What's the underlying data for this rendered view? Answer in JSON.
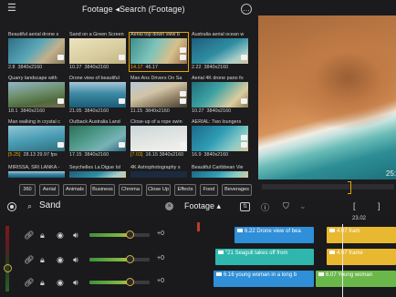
{
  "header": {
    "title": "Footage ◂Search (Footage)"
  },
  "grid": [
    {
      "caption": "Beautiful aerial drone s",
      "duration": "2.8",
      "resolution": "3840x2160",
      "thumb": "beach1",
      "selected": false
    },
    {
      "caption": "Sand on a Green Screen",
      "duration": "10.27",
      "resolution": "3840x2160",
      "thumb": "sand",
      "selected": false
    },
    {
      "caption": "Aerial top down view b",
      "duration": "14.17",
      "resolution": "46.17",
      "thumb": "aerial",
      "selected": true,
      "highlight": true
    },
    {
      "caption": "Australia aerial ocean w",
      "duration": "2.22",
      "resolution": "3840x2160",
      "thumb": "ocean",
      "selected": false
    },
    {
      "caption": "Quarry landscape with",
      "duration": "18.1",
      "resolution": "3840x2160",
      "thumb": "quarry",
      "selected": false
    },
    {
      "caption": "Drone view of beautiful",
      "duration": "21.05",
      "resolution": "3840x2160",
      "thumb": "drone",
      "selected": false
    },
    {
      "caption": "Man Ans Drivers On Sa",
      "duration": "11.15",
      "resolution": "3840x2160",
      "thumb": "road",
      "selected": false
    },
    {
      "caption": "Aerial 4K drone pano fo",
      "duration": "10.27",
      "resolution": "3840x2160",
      "thumb": "drone2",
      "selected": false
    },
    {
      "caption": "Man walking in crystal c",
      "duration": "[5.25]",
      "resolution": "28.13  29.97 fps",
      "thumb": "walk",
      "selected": false,
      "highlight": true
    },
    {
      "caption": "Outback Australia Land",
      "duration": "17.15",
      "resolution": "3840x2160",
      "thumb": "outback",
      "selected": false
    },
    {
      "caption": "Close-up of a rope swin",
      "duration": "[7.03]",
      "resolution": "16.15  3840x2160",
      "thumb": "rope",
      "selected": false,
      "highlight": true
    },
    {
      "caption": "AERIAL: Two loungers",
      "duration": "16.9",
      "resolution": "3840x2160",
      "thumb": "lagoon",
      "selected": false
    }
  ],
  "grid_bottom_captions": [
    "MIRISSA, SRI LANKA -",
    "Seychelles La Digue Isl",
    "4K Astrophotography s",
    "Beautiful Caribbean Vie"
  ],
  "tags": [
    "360",
    "Aerial",
    "Animals",
    "Business",
    "Chroma",
    "Close Up",
    "Effects",
    "Food",
    "Beverages"
  ],
  "search": {
    "value": "Sand",
    "filter_label": "Footage ▴"
  },
  "viewer": {
    "timecode": "25:"
  },
  "timeline": {
    "timecode": "23.02",
    "tracks": [
      {
        "volume": "+0",
        "level": 0.72
      },
      {
        "volume": "+0",
        "level": 0.72
      },
      {
        "volume": "+0",
        "level": 0.72
      }
    ],
    "clips": [
      {
        "label": "6.22  Drone view of bea",
        "color": "#2f8fd8"
      },
      {
        "label": "4.07  fram",
        "color": "#e8b830"
      },
      {
        "label": "\"21  Seagull takes off from",
        "color": "#2fb7ad"
      },
      {
        "label": "4.07  frame",
        "color": "#e8b830"
      },
      {
        "label": "6.16  young woman in a long b",
        "color": "#2f8fd8"
      },
      {
        "label": "6.07  Young woman",
        "color": "#6ab84a"
      }
    ]
  },
  "colors": {
    "accent": "#e8a400",
    "background": "#1c1c1e"
  }
}
